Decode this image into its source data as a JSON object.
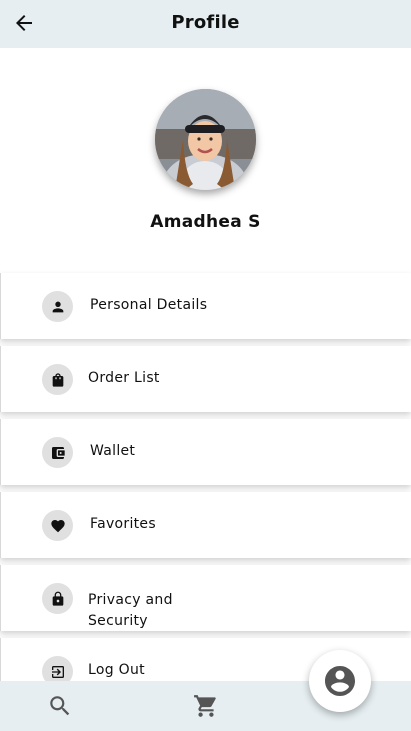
{
  "header": {
    "title": "Profile",
    "back_icon": "arrow-left-icon"
  },
  "profile": {
    "name": "Amadhea S"
  },
  "menu": [
    {
      "label": "Personal Details",
      "icon": "person-icon"
    },
    {
      "label": "Order List",
      "icon": "shopping-bag-icon"
    },
    {
      "label": "Wallet",
      "icon": "wallet-icon"
    },
    {
      "label": "Favorites",
      "icon": "heart-icon"
    },
    {
      "label_line1": "Privacy and",
      "label_line2": "Security",
      "icon": "lock-icon"
    },
    {
      "label": "Log Out",
      "icon": "logout-icon"
    }
  ],
  "bottom_nav": [
    {
      "icon": "search-icon"
    },
    {
      "icon": "cart-icon"
    },
    {
      "icon": "account-circle-icon",
      "active": true
    }
  ],
  "colors": {
    "header_bg": "#e6eef1",
    "icon_bg": "#e0e0e0",
    "text": "#111111"
  }
}
